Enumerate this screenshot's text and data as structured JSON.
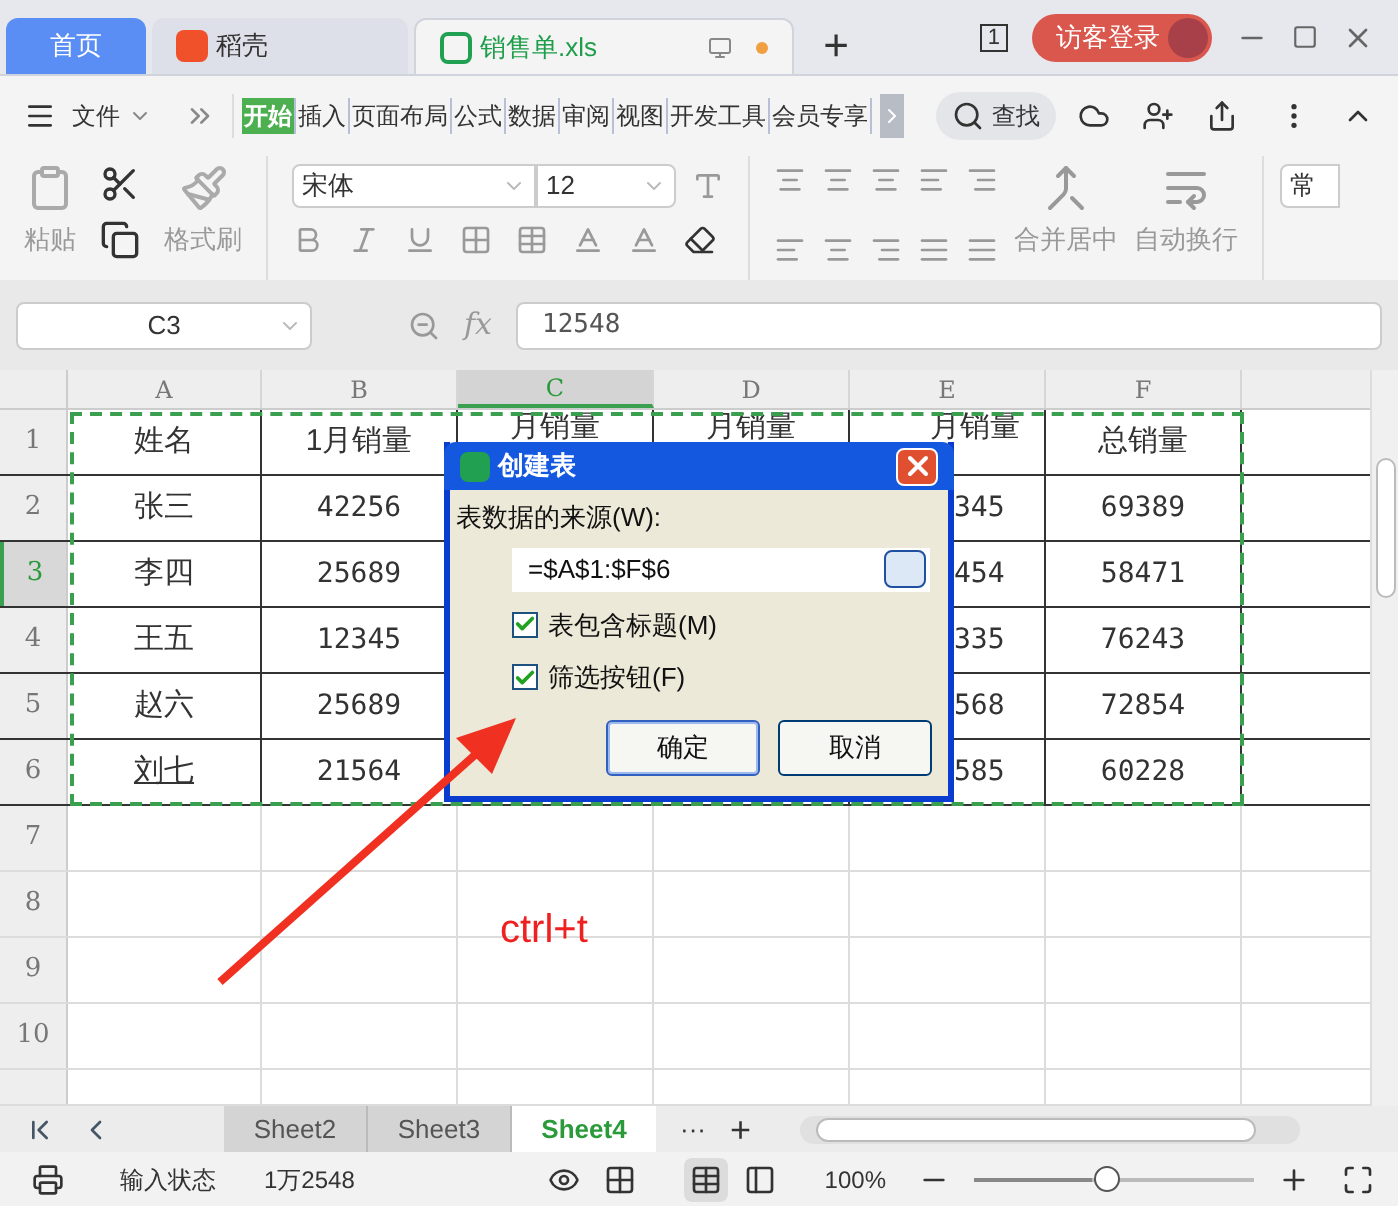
{
  "tabs": [
    {
      "label": "首页",
      "kind": "home",
      "selected": false
    },
    {
      "label": "稻壳",
      "kind": "docer",
      "selected": false
    },
    {
      "label": "销售单.xls",
      "kind": "file",
      "selected": true
    }
  ],
  "new_tab": "+",
  "window_count": "1",
  "login": "访客登录",
  "menu": {
    "file": "文件"
  },
  "ribbon_tabs": [
    {
      "label": "开始",
      "selected": true
    },
    {
      "label": "插入",
      "selected": false
    },
    {
      "label": "页面布局",
      "selected": false
    },
    {
      "label": "公式",
      "selected": false
    },
    {
      "label": "数据",
      "selected": false
    },
    {
      "label": "审阅",
      "selected": false
    },
    {
      "label": "视图",
      "selected": false
    },
    {
      "label": "开发工具",
      "selected": false
    },
    {
      "label": "会员专享",
      "selected": false
    }
  ],
  "search": "查找",
  "toolbar": {
    "paste": "粘贴",
    "format_painter": "格式刷",
    "font": "宋体",
    "font_size": "12",
    "merge": "合并居中",
    "wrap": "自动换行",
    "number_format": "常"
  },
  "formula_bar": {
    "cell": "C3",
    "fx": "fx",
    "value": "12548"
  },
  "columns": [
    {
      "label": "A",
      "selected": false
    },
    {
      "label": "B",
      "selected": false
    },
    {
      "label": "C",
      "selected": true
    },
    {
      "label": "D",
      "selected": false
    },
    {
      "label": "E",
      "selected": false
    },
    {
      "label": "F",
      "selected": false
    }
  ],
  "header_row": {
    "number": "1",
    "cells": [
      "姓名",
      "1月销量",
      "月销量",
      "月销量",
      "月销量",
      "总销量"
    ]
  },
  "rows": [
    {
      "number": "2",
      "selected": false,
      "name": "张三",
      "underlined": false,
      "sales_1": "42256",
      "col_e": "345",
      "total": "69389"
    },
    {
      "number": "3",
      "selected": true,
      "name": "李四",
      "underlined": false,
      "sales_1": "25689",
      "col_e": "454",
      "total": "58471"
    },
    {
      "number": "4",
      "selected": false,
      "name": "王五",
      "underlined": false,
      "sales_1": "12345",
      "col_e": "335",
      "total": "76243"
    },
    {
      "number": "5",
      "selected": false,
      "name": "赵六",
      "underlined": false,
      "sales_1": "25689",
      "col_e": "568",
      "total": "72854"
    },
    {
      "number": "6",
      "selected": false,
      "name": "刘七",
      "underlined": true,
      "sales_1": "21564",
      "col_e": "585",
      "total": "60228"
    }
  ],
  "empty_rows": [
    "7",
    "8",
    "9",
    "10"
  ],
  "dialog": {
    "title": "创建表",
    "source_label": "表数据的来源(W):",
    "range": "=$A$1:$F$6",
    "checkboxes": [
      {
        "label": "表包含标题(M)",
        "checked": true
      },
      {
        "label": "筛选按钮(F)",
        "checked": true
      }
    ],
    "buttons": [
      "确定",
      "取消"
    ]
  },
  "annotation": "ctrl+t",
  "sheets": [
    {
      "label": "Sheet2",
      "selected": false
    },
    {
      "label": "Sheet3",
      "selected": false
    },
    {
      "label": "Sheet4",
      "selected": true
    }
  ],
  "sheet_more": "···",
  "sheet_add": "+",
  "status": {
    "mode": "输入状态",
    "value": "1万2548",
    "zoom": "100%",
    "level": 0.47
  }
}
